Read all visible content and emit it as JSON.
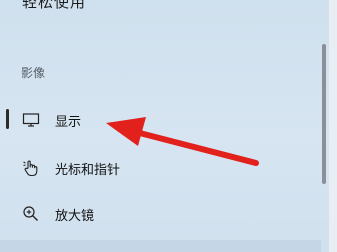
{
  "top_cut_text": "轻松使用",
  "section": {
    "header": "影像"
  },
  "nav": {
    "items": [
      {
        "label": "显示",
        "icon": "monitor-icon",
        "selected": true
      },
      {
        "label": "光标和指针",
        "icon": "pointer-hand-icon",
        "selected": false
      },
      {
        "label": "放大镜",
        "icon": "magnifier-icon",
        "selected": false
      }
    ]
  },
  "colors": {
    "background": "#d4e3f0",
    "arrow": "#e2201c",
    "selected_indicator": "#2b2b2b"
  }
}
